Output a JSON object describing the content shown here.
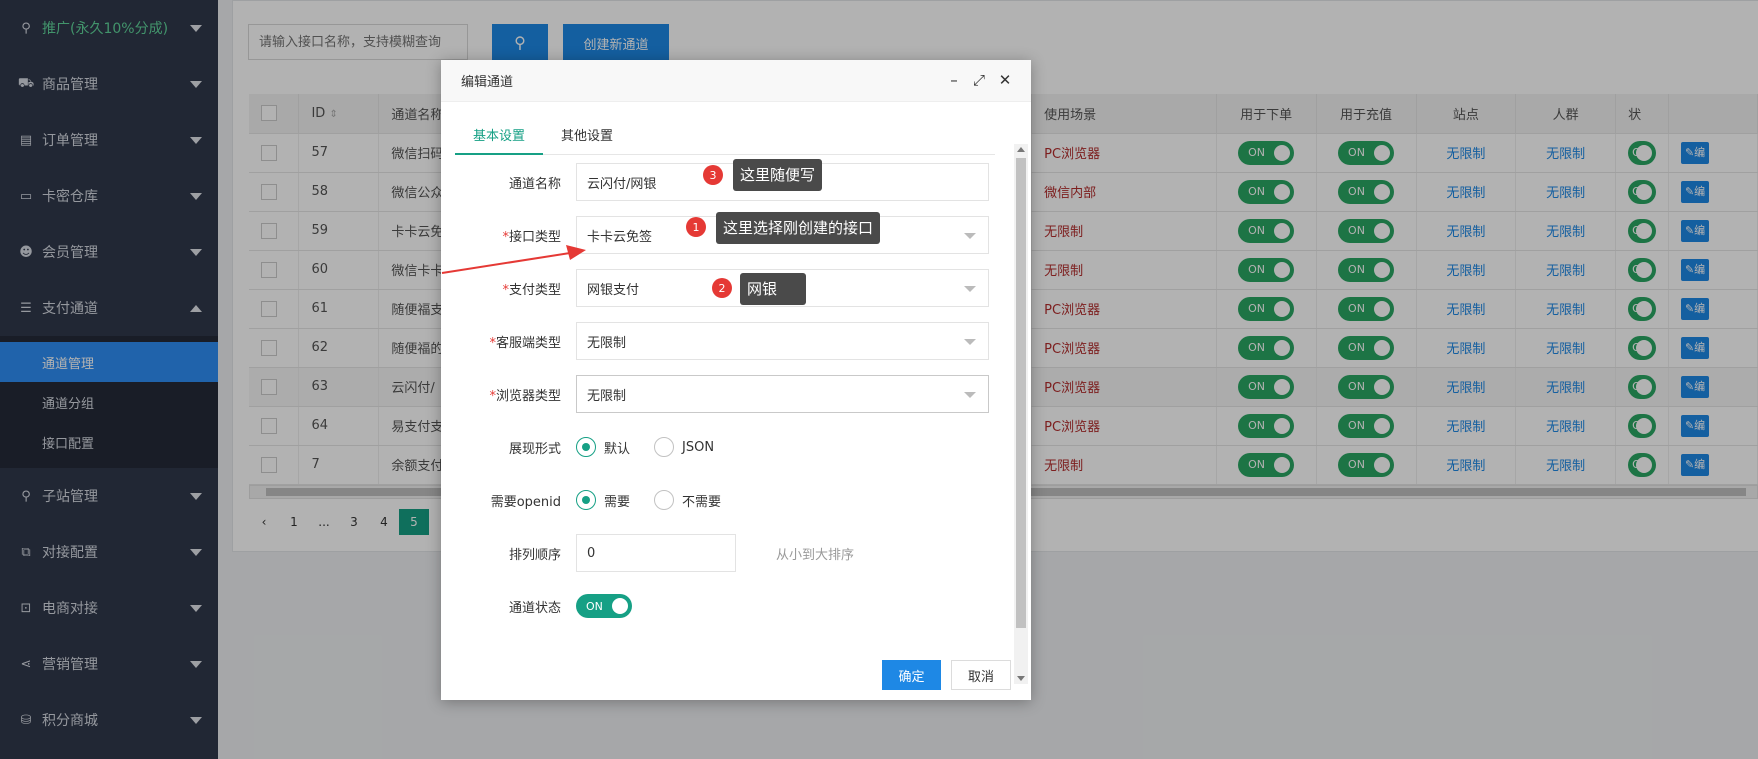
{
  "sidebar": {
    "items": [
      {
        "label": "推广(永久10%分成)",
        "icon": "sitemap-icon"
      },
      {
        "label": "商品管理",
        "icon": "cart-icon"
      },
      {
        "label": "订单管理",
        "icon": "clipboard-icon"
      },
      {
        "label": "卡密仓库",
        "icon": "card-icon"
      },
      {
        "label": "会员管理",
        "icon": "users-icon"
      },
      {
        "label": "支付通道",
        "icon": "list-icon"
      },
      {
        "label": "子站管理",
        "icon": "sitemap-icon"
      },
      {
        "label": "对接配置",
        "icon": "connect-icon"
      },
      {
        "label": "电商对接",
        "icon": "lock-icon"
      },
      {
        "label": "营销管理",
        "icon": "share-icon"
      },
      {
        "label": "积分商城",
        "icon": "database-icon"
      }
    ],
    "sub_items": [
      "通道管理",
      "通道分组",
      "接口配置"
    ]
  },
  "toolbar": {
    "search_placeholder": "请输入接口名称，支持模糊查询",
    "create_label": "创建新通道"
  },
  "table": {
    "headers": [
      "ID",
      "通道名称",
      "使用场景",
      "用于下单",
      "用于充值",
      "站点",
      "人群",
      "状"
    ],
    "rows": [
      {
        "id": "57",
        "name": "微信扫码",
        "scene": "PC浏览器"
      },
      {
        "id": "58",
        "name": "微信公众",
        "scene": "微信内部"
      },
      {
        "id": "59",
        "name": "卡卡云免",
        "scene": "无限制"
      },
      {
        "id": "60",
        "name": "微信卡卡",
        "scene": "无限制"
      },
      {
        "id": "61",
        "name": "随便福支",
        "scene": "PC浏览器"
      },
      {
        "id": "62",
        "name": "随便福的",
        "scene": "PC浏览器"
      },
      {
        "id": "63",
        "name": "云闪付/",
        "scene": "PC浏览器"
      },
      {
        "id": "64",
        "name": "易支付支",
        "scene": "PC浏览器"
      },
      {
        "id": "7",
        "name": "余额支付",
        "scene": "无限制"
      }
    ],
    "toggle_on": "ON",
    "unlimited": "无限制",
    "edit_label": "编"
  },
  "pagination": {
    "pages": [
      "1",
      "...",
      "3",
      "4",
      "5"
    ],
    "current": "5"
  },
  "dialog": {
    "title": "编辑通道",
    "tabs": [
      "基本设置",
      "其他设置"
    ],
    "fields": {
      "name": {
        "label": "通道名称",
        "value": "云闪付/网银"
      },
      "interface": {
        "label": "接口类型",
        "value": "卡卡云免签"
      },
      "pay_type": {
        "label": "支付类型",
        "value": "网银支付"
      },
      "client_type": {
        "label": "客服端类型",
        "value": "无限制"
      },
      "browser_type": {
        "label": "浏览器类型",
        "value": "无限制"
      },
      "display": {
        "label": "展现形式",
        "opt1": "默认",
        "opt2": "JSON"
      },
      "openid": {
        "label": "需要openid",
        "opt1": "需要",
        "opt2": "不需要"
      },
      "order": {
        "label": "排列顺序",
        "value": "0",
        "hint": "从小到大排序"
      },
      "status": {
        "label": "通道状态",
        "value": "ON"
      }
    },
    "ok_label": "确定",
    "cancel_label": "取消"
  },
  "annotations": {
    "tip1": "这里选择刚创建的接口",
    "tip2": "网银",
    "tip3": "这里随便写",
    "n1": "1",
    "n2": "2",
    "n3": "3"
  }
}
